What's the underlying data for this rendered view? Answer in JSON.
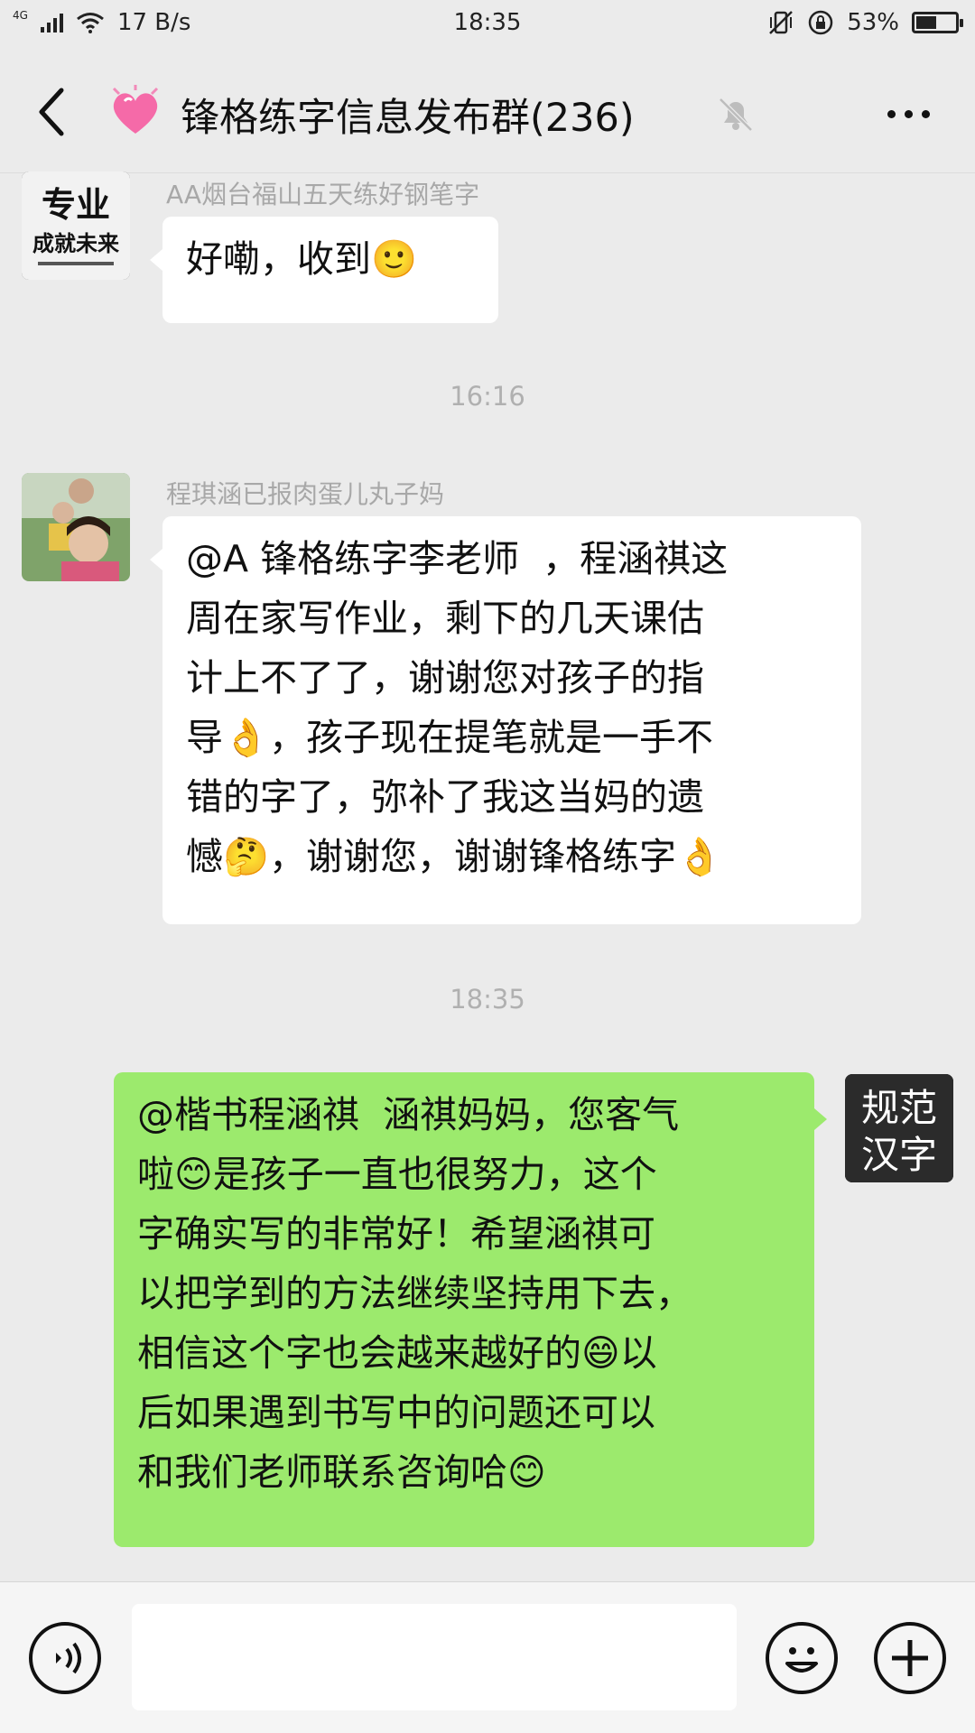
{
  "status": {
    "network": "4G",
    "speed": "17 B/s",
    "time": "18:35",
    "battery_percent_label": "53%",
    "battery_level": 0.53
  },
  "nav": {
    "title": "锋格练字信息发布群(236)"
  },
  "messages": [
    {
      "sender": "AA烟台福山五天练好钢笔字",
      "text": "好嘞，收到🙂",
      "avatar_lines": [
        "专业",
        "成就未来"
      ]
    },
    {
      "divider": "16:16"
    },
    {
      "sender": "程琪涵已报肉蛋儿丸子妈",
      "text": "@A 锋格练字李老师  ，程涵祺这\n周在家写作业，剩下的几天课估\n计上不了了，谢谢您对孩子的指\n导👌，孩子现在提笔就是一手不\n错的字了，弥补了我这当妈的遗\n憾🤔，谢谢您，谢谢锋格练字👌"
    },
    {
      "divider": "18:35"
    },
    {
      "text": "@楷书程涵祺  涵祺妈妈，您客气\n啦😊是孩子一直也很努力，这个\n字确实写的非常好！希望涵祺可\n以把学到的方法继续坚持用下去，\n相信这个字也会越来越好的😄以\n后如果遇到书写中的问题还可以\n和我们老师联系咨询哈😊",
      "avatar_lines": [
        "规范",
        "汉字"
      ]
    }
  ],
  "colors": {
    "background": "#ebebeb",
    "bubble_self": "#9cea6d",
    "bubble_other": "#ffffff",
    "muted_text": "#a8a8a8"
  },
  "icons": [
    "back-arrow-icon",
    "heart-icon",
    "mute-bell-icon",
    "more-icon",
    "voice-icon",
    "emoji-icon",
    "plus-icon"
  ]
}
